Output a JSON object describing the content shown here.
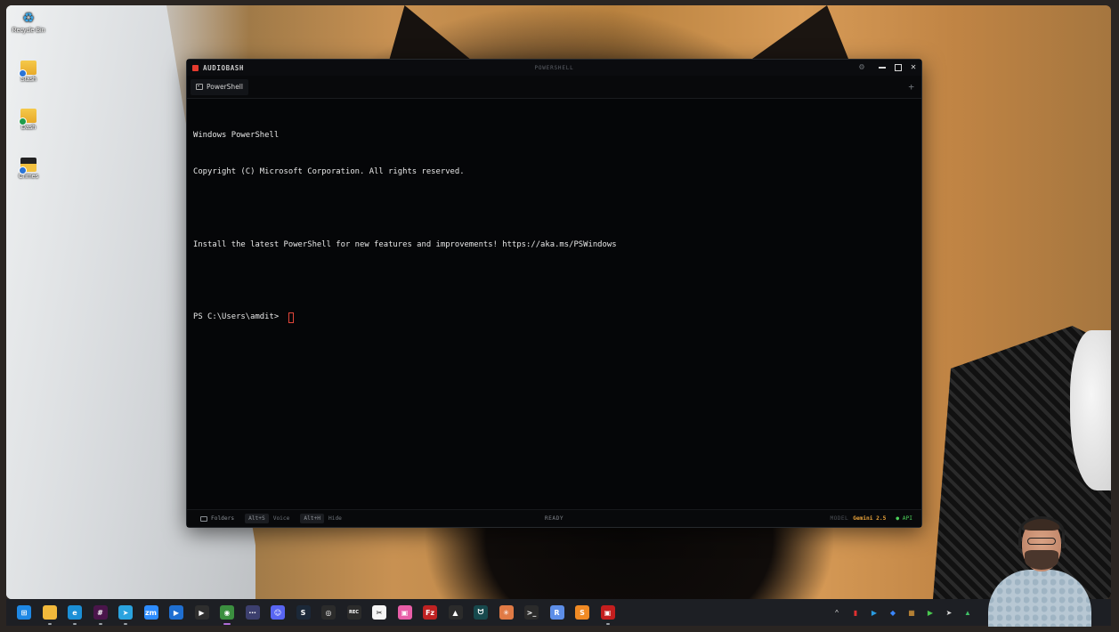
{
  "desktop": {
    "icons": [
      {
        "label": "Recycle Bin",
        "icon": "recycle-bin-icon"
      },
      {
        "label": "Stash",
        "icon": "folder-icon"
      },
      {
        "label": "Dash",
        "icon": "folder-icon"
      },
      {
        "label": "Crimes",
        "icon": "folder-icon"
      }
    ]
  },
  "window": {
    "app_name": "AUDIOBASH",
    "center_title": "POWERSHELL",
    "accent_color": "#e63b2e",
    "tabs": [
      {
        "label": "PowerShell",
        "active": true
      }
    ],
    "add_tab_glyph": "+"
  },
  "terminal": {
    "lines": [
      "Windows PowerShell",
      "Copyright (C) Microsoft Corporation. All rights reserved.",
      "",
      "Install the latest PowerShell for new features and improvements! https://aka.ms/PSWindows",
      ""
    ],
    "prompt": "PS C:\\Users\\amdit> "
  },
  "statusbar": {
    "folders_label": "Folders",
    "voice_shortcut": "Alt+S",
    "voice_label": "Voice",
    "hide_shortcut": "Alt+H",
    "hide_label": "Hide",
    "status": "READY",
    "model_label": "MODEL",
    "model_name": "Gemini 2.5",
    "api_label": "● API",
    "model_color": "#e8a23a",
    "api_color": "#4cd15a"
  },
  "taskbar": {
    "apps": [
      {
        "name": "start",
        "glyph": "⊞",
        "bg": "#1e88e5"
      },
      {
        "name": "file-explorer",
        "glyph": "",
        "bg": "#f2b93b"
      },
      {
        "name": "edge",
        "glyph": "e",
        "bg": "#1b8fd6"
      },
      {
        "name": "slack",
        "glyph": "#",
        "bg": "#4a154b"
      },
      {
        "name": "telegram",
        "glyph": "➤",
        "bg": "#2aa3df"
      },
      {
        "name": "zoom",
        "glyph": "zm",
        "bg": "#2d8cff"
      },
      {
        "name": "app-blue",
        "glyph": "▶",
        "bg": "#1f6fd1"
      },
      {
        "name": "app-green",
        "glyph": "▶",
        "bg": "#2e2e2e"
      },
      {
        "name": "chrome",
        "glyph": "◉",
        "bg": "#3b8f3f"
      },
      {
        "name": "app-dots",
        "glyph": "⋯",
        "bg": "#3c3f6e"
      },
      {
        "name": "discord",
        "glyph": "☺",
        "bg": "#5865f2"
      },
      {
        "name": "steam",
        "glyph": "S",
        "bg": "#1b2838"
      },
      {
        "name": "obs",
        "glyph": "◎",
        "bg": "#2b2b2b"
      },
      {
        "name": "recorder",
        "glyph": "REC",
        "bg": "#2b2b2b"
      },
      {
        "name": "capcut",
        "glyph": "✂",
        "bg": "#f5f5f5"
      },
      {
        "name": "photos",
        "glyph": "▣",
        "bg": "#e85ea8"
      },
      {
        "name": "filezilla",
        "glyph": "Fz",
        "bg": "#bf2222"
      },
      {
        "name": "app-hat",
        "glyph": "▲",
        "bg": "#2b2b2b"
      },
      {
        "name": "app-teal",
        "glyph": "ᗢ",
        "bg": "#17494d"
      },
      {
        "name": "claude",
        "glyph": "✳",
        "bg": "#e07a45"
      },
      {
        "name": "terminal",
        "glyph": ">_",
        "bg": "#2b2b2b"
      },
      {
        "name": "app-r",
        "glyph": "R",
        "bg": "#5d8ee8"
      },
      {
        "name": "sublime",
        "glyph": "S",
        "bg": "#f08a24"
      },
      {
        "name": "audiobash",
        "glyph": "▣",
        "bg": "#c41e1e"
      }
    ],
    "tray": [
      {
        "name": "overflow",
        "glyph": "^"
      },
      {
        "name": "tray-red",
        "glyph": "▮"
      },
      {
        "name": "tray-blue",
        "glyph": "▶"
      },
      {
        "name": "tray-dropbox",
        "glyph": "◆"
      },
      {
        "name": "tray-store",
        "glyph": "▦"
      },
      {
        "name": "tray-play",
        "glyph": "▶"
      },
      {
        "name": "tray-send",
        "glyph": "➤"
      },
      {
        "name": "tray-green",
        "glyph": "▲"
      }
    ]
  }
}
